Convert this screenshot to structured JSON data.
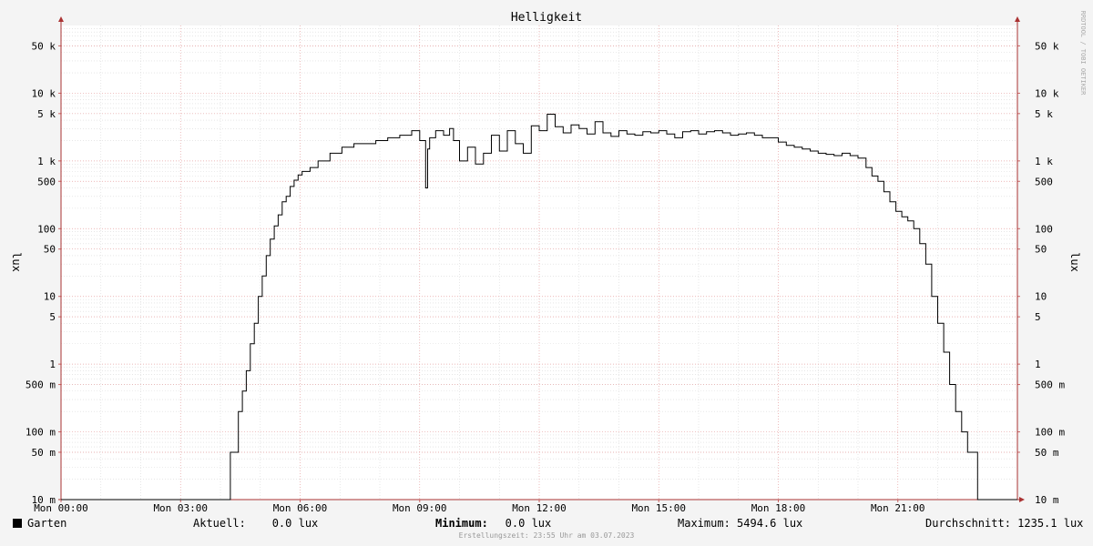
{
  "chart_data": {
    "type": "line",
    "title": "Helligkeit",
    "ylabel": "lux",
    "ylabel_right": "lux",
    "y_scale": "log",
    "ylim": [
      0.01,
      100000
    ],
    "xlim": [
      0,
      24
    ],
    "x_unit": "hours",
    "x_ticks": [
      {
        "x": 0,
        "label": "Mon 00:00"
      },
      {
        "x": 3,
        "label": "Mon 03:00"
      },
      {
        "x": 6,
        "label": "Mon 06:00"
      },
      {
        "x": 9,
        "label": "Mon 09:00"
      },
      {
        "x": 12,
        "label": "Mon 12:00"
      },
      {
        "x": 15,
        "label": "Mon 15:00"
      },
      {
        "x": 18,
        "label": "Mon 18:00"
      },
      {
        "x": 21,
        "label": "Mon 21:00"
      }
    ],
    "y_ticks": [
      {
        "v": 0.01,
        "label": "10 m"
      },
      {
        "v": 0.05,
        "label": "50 m"
      },
      {
        "v": 0.1,
        "label": "100 m"
      },
      {
        "v": 0.5,
        "label": "500 m"
      },
      {
        "v": 1,
        "label": "1"
      },
      {
        "v": 5,
        "label": "5"
      },
      {
        "v": 10,
        "label": "10"
      },
      {
        "v": 50,
        "label": "50"
      },
      {
        "v": 100,
        "label": "100"
      },
      {
        "v": 500,
        "label": "500"
      },
      {
        "v": 1000,
        "label": "1 k"
      },
      {
        "v": 5000,
        "label": "5 k"
      },
      {
        "v": 10000,
        "label": "10 k"
      },
      {
        "v": 50000,
        "label": "50 k"
      }
    ],
    "grid": true,
    "series": [
      {
        "name": "Garten",
        "color": "#000000",
        "x": [
          0,
          4.2,
          4.25,
          4.45,
          4.55,
          4.65,
          4.75,
          4.85,
          4.95,
          5.05,
          5.15,
          5.25,
          5.35,
          5.45,
          5.55,
          5.65,
          5.75,
          5.85,
          5.95,
          6.05,
          6.25,
          6.45,
          6.75,
          7.05,
          7.35,
          7.6,
          7.9,
          8.2,
          8.5,
          8.8,
          9.0,
          9.15,
          9.2,
          9.25,
          9.4,
          9.6,
          9.75,
          9.85,
          10.0,
          10.2,
          10.4,
          10.6,
          10.8,
          11.0,
          11.2,
          11.4,
          11.6,
          11.8,
          12.0,
          12.2,
          12.4,
          12.6,
          12.8,
          13.0,
          13.2,
          13.4,
          13.6,
          13.8,
          14.0,
          14.2,
          14.4,
          14.6,
          14.8,
          15.0,
          15.2,
          15.4,
          15.6,
          15.8,
          16.0,
          16.2,
          16.4,
          16.6,
          16.8,
          17.0,
          17.2,
          17.4,
          17.6,
          17.8,
          18.0,
          18.2,
          18.4,
          18.6,
          18.8,
          19.0,
          19.2,
          19.4,
          19.6,
          19.8,
          20.0,
          20.2,
          20.35,
          20.5,
          20.65,
          20.8,
          20.95,
          21.1,
          21.25,
          21.4,
          21.55,
          21.7,
          21.85,
          22.0,
          22.15,
          22.3,
          22.45,
          22.6,
          22.75,
          22.9,
          23.0,
          23.05,
          24.0
        ],
        "y": [
          0.01,
          0.01,
          0.05,
          0.2,
          0.4,
          0.8,
          2,
          4,
          10,
          20,
          40,
          70,
          110,
          160,
          250,
          300,
          420,
          520,
          620,
          700,
          800,
          1000,
          1300,
          1600,
          1800,
          1800,
          2000,
          2200,
          2400,
          2800,
          2000,
          400,
          1500,
          2200,
          2800,
          2400,
          3000,
          2000,
          1000,
          1600,
          900,
          1300,
          2400,
          1400,
          2800,
          1800,
          1300,
          3300,
          2800,
          4900,
          3200,
          2600,
          3400,
          3000,
          2500,
          3800,
          2600,
          2300,
          2800,
          2500,
          2400,
          2700,
          2600,
          2800,
          2500,
          2200,
          2700,
          2800,
          2500,
          2700,
          2800,
          2600,
          2400,
          2500,
          2600,
          2400,
          2200,
          2200,
          1900,
          1700,
          1600,
          1500,
          1400,
          1300,
          1250,
          1200,
          1300,
          1200,
          1100,
          800,
          600,
          500,
          350,
          250,
          180,
          150,
          130,
          100,
          60,
          30,
          10,
          4,
          1.5,
          0.5,
          0.2,
          0.1,
          0.05,
          0.05,
          0.01,
          0.01,
          0.01
        ]
      }
    ]
  },
  "watermark": "RRDTOOL / TOBI OETIKER",
  "legend": {
    "series_label": "Garten",
    "current": "Aktuell:    0.0 lux",
    "minimum_label": "Minimum:",
    "minimum_value": "   0.0 lux",
    "maximum": "Maximum: 5494.6 lux",
    "average": "Durchschnitt: 1235.1 lux"
  },
  "creation_time": "Erstellungszeit: 23:55 Uhr am 03.07.2023"
}
